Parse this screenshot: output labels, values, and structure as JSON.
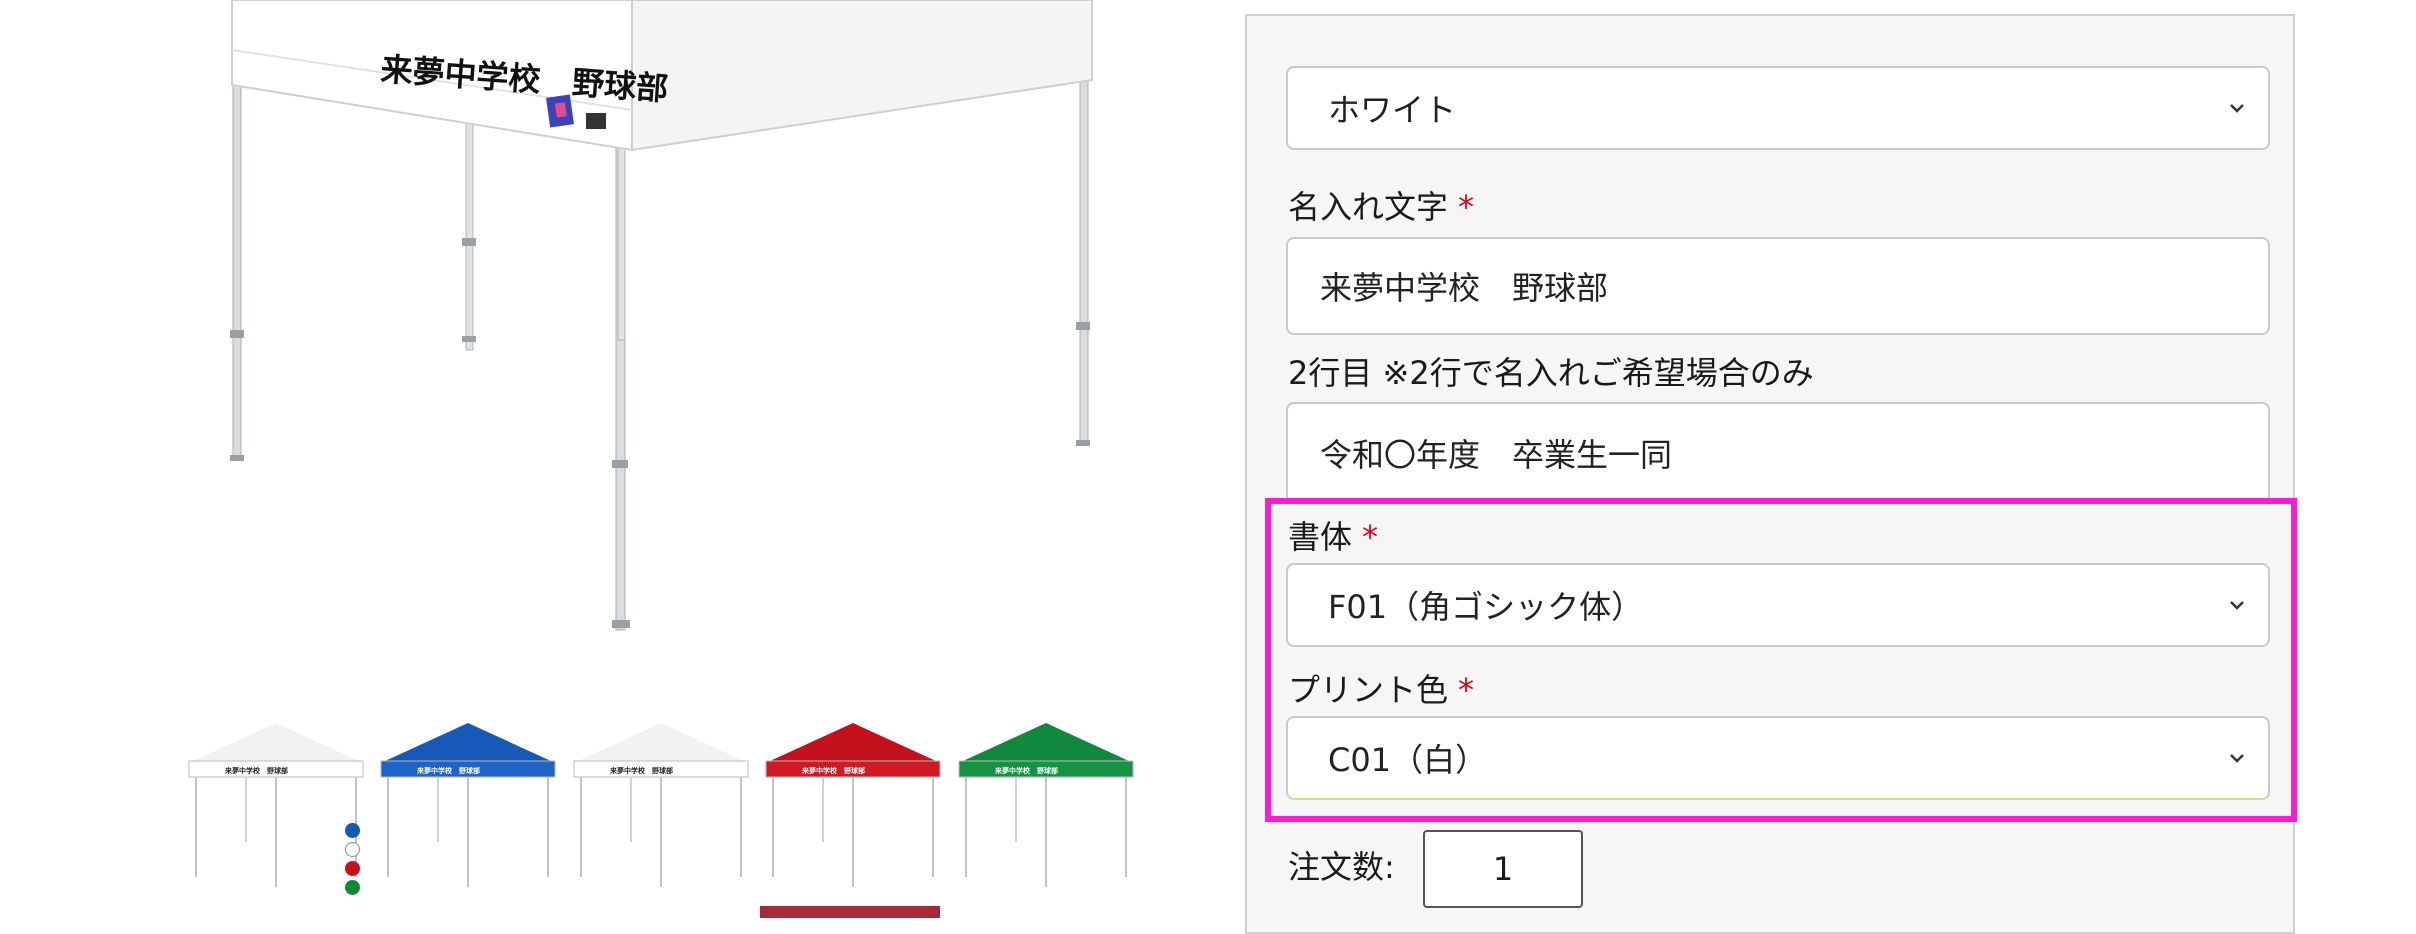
{
  "product": {
    "banner_text": "来夢中学校　野球部",
    "thumbnails": [
      {
        "name": "white",
        "canopy": "#f2f2f2",
        "valance": "#ffffff",
        "text": "#222222"
      },
      {
        "name": "blue",
        "canopy": "#1659b8",
        "valance": "#1f63c4",
        "text": "#ffffff"
      },
      {
        "name": "white-2",
        "canopy": "#f2f2f2",
        "valance": "#ffffff",
        "text": "#222222"
      },
      {
        "name": "red",
        "canopy": "#c4121d",
        "valance": "#cf1a24",
        "text": "#ffffff"
      },
      {
        "name": "green",
        "canopy": "#11893d",
        "valance": "#149443",
        "text": "#ffffff"
      }
    ],
    "swatch_colors": [
      "#1559b3",
      "#ffffff",
      "#c8101b",
      "#0c8a3a"
    ]
  },
  "form": {
    "color_select": {
      "value": "ホワイト"
    },
    "name_text": {
      "label": "名入れ文字",
      "required_mark": "*",
      "value": "来夢中学校　野球部"
    },
    "second_line": {
      "label": "2行目 ※2行で名入れご希望場合のみ",
      "value": "令和〇年度　卒業生一同"
    },
    "font_select": {
      "label": "書体",
      "required_mark": "*",
      "value": "F01（角ゴシック体）"
    },
    "print_color_select": {
      "label": "プリント色",
      "required_mark": "*",
      "value": "C01（白）"
    },
    "quantity": {
      "label": "注文数:",
      "value": "1"
    }
  },
  "accent": {
    "highlight": "#ff1bd6",
    "required": "#e0001b"
  }
}
